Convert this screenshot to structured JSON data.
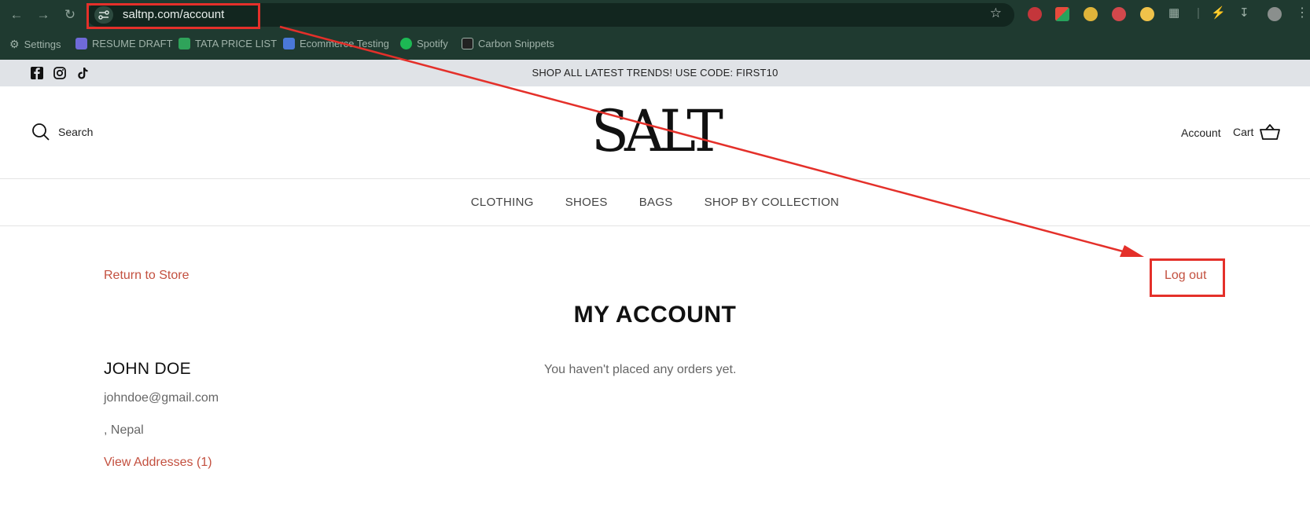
{
  "browser": {
    "url": "saltnp.com/account",
    "bookmarks": [
      {
        "label": "Settings",
        "color": "#9fb2a9"
      },
      {
        "label": "RESUME DRAFT",
        "color": "#6f6ad8"
      },
      {
        "label": "TATA PRICE LIST",
        "color": "#2fa35a"
      },
      {
        "label": "Ecommerce Testing",
        "color": "#4a78d8"
      },
      {
        "label": "Spotify",
        "color": "#1db954"
      },
      {
        "label": "Carbon Snippets",
        "color": "#222222"
      }
    ]
  },
  "announcement": {
    "text": "SHOP ALL LATEST TRENDS! USE CODE: FIRST10",
    "social_icons": [
      "facebook-icon",
      "instagram-icon",
      "tiktok-icon"
    ]
  },
  "header": {
    "search_label": "Search",
    "logo_text": "SALT",
    "account_label": "Account",
    "cart_label": "Cart"
  },
  "menu": {
    "items": [
      "CLOTHING",
      "SHOES",
      "BAGS",
      "SHOP BY COLLECTION"
    ]
  },
  "account": {
    "return_label": "Return to Store",
    "logout_label": "Log out",
    "title": "MY ACCOUNT",
    "customer_name": "JOHN DOE",
    "email": "johndoe@gmail.com",
    "address": ", Nepal",
    "view_addresses_label": "View Addresses (1)",
    "orders_empty_text": "You haven't placed any orders yet."
  },
  "colors": {
    "chrome_bg": "#1f3a30",
    "accent_link": "#c3503f",
    "annotation": "#e4302a"
  }
}
